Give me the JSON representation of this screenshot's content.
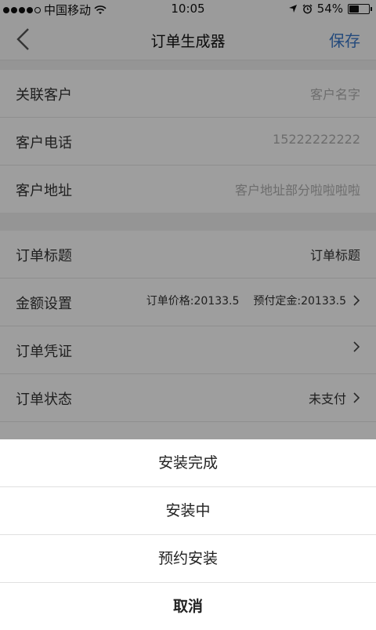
{
  "status_bar": {
    "carrier": "中国移动",
    "time": "10:05",
    "battery": "54%",
    "battery_level": 0.54
  },
  "nav": {
    "title": "订单生成器",
    "save_label": "保存"
  },
  "customer": {
    "name_label": "关联客户",
    "name_placeholder": "客户名字",
    "phone_label": "客户电话",
    "phone_value": "15222222222",
    "address_label": "客户地址",
    "address_placeholder": "客户地址部分啦啦啦啦"
  },
  "order": {
    "title_label": "订单标题",
    "title_value": "订单标题",
    "amount_label": "金额设置",
    "price_text": "订单价格:20133.5",
    "deposit_text": "预付定金:20133.5",
    "voucher_label": "订单凭证",
    "status_label": "订单状态",
    "status_value": "未支付"
  },
  "action_sheet": {
    "items": [
      "安装完成",
      "安装中",
      "预约安装"
    ],
    "cancel_label": "取消"
  },
  "colors": {
    "accent": "#3a78c8",
    "placeholder": "#b0b0b0"
  }
}
